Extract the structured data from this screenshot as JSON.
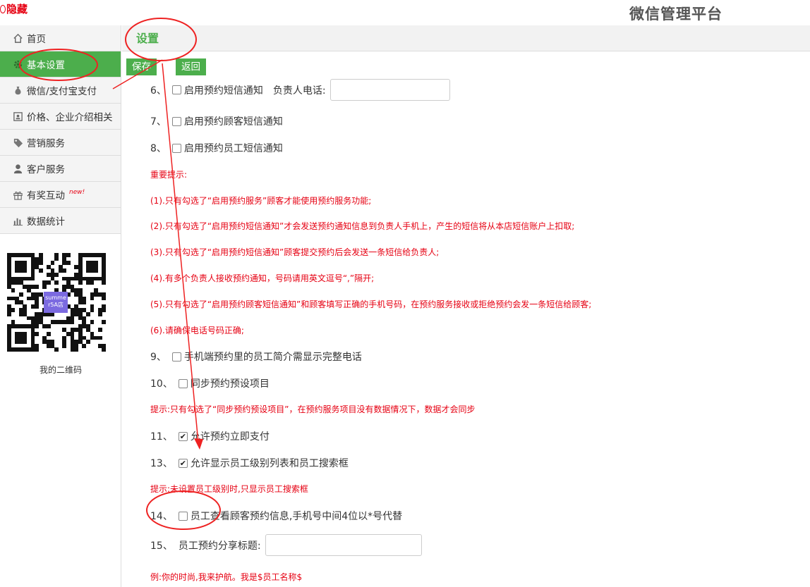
{
  "header": {
    "hide_label": "隐藏",
    "brand_title": "微信管理平台"
  },
  "sidebar": {
    "items": [
      {
        "label": "首页",
        "icon": "home-icon",
        "new_badge": ""
      },
      {
        "label": "基本设置",
        "icon": "gear-icon",
        "new_badge": ""
      },
      {
        "label": "微信/支付宝支付",
        "icon": "money-bag-icon",
        "new_badge": ""
      },
      {
        "label": "价格、企业介绍相关",
        "icon": "id-card-icon",
        "new_badge": ""
      },
      {
        "label": "营销服务",
        "icon": "tag-icon",
        "new_badge": ""
      },
      {
        "label": "客户服务",
        "icon": "user-icon",
        "new_badge": ""
      },
      {
        "label": "有奖互动",
        "icon": "gift-icon",
        "new_badge": "new!"
      },
      {
        "label": "数据统计",
        "icon": "bar-chart-icon",
        "new_badge": ""
      }
    ],
    "qr_badge": "summe r5A店",
    "qr_label": "我的二维码"
  },
  "page": {
    "title": "设置",
    "save_label": "保存",
    "back_label": "返回"
  },
  "settings": {
    "s6": {
      "num": "6、",
      "label": "启用预约短信通知",
      "checked": false,
      "field_label": "负责人电话:",
      "field_value": ""
    },
    "s7": {
      "num": "7、",
      "label": "启用预约顾客短信通知",
      "checked": false
    },
    "s8": {
      "num": "8、",
      "label": "启用预约员工短信通知",
      "checked": false
    },
    "tips_title": "重要提示:",
    "tips": [
      "(1).只有勾选了“启用预约服务”顾客才能使用预约服务功能;",
      "(2).只有勾选了“启用预约短信通知”才会发送预约通知信息到负责人手机上，产生的短信将从本店短信账户上扣取;",
      "(3).只有勾选了“启用预约短信通知”顾客提交预约后会发送一条短信给负责人;",
      "(4).有多个负责人接收预约通知，号码请用英文逗号“,”隔开;",
      "(5).只有勾选了“启用预约顾客短信通知”和顾客填写正确的手机号码，在预约服务接收或拒绝预约会发一条短信给顾客;",
      "(6).请确保电话号码正确;"
    ],
    "s9": {
      "num": "9、",
      "label": "手机端预约里的员工简介需显示完整电话",
      "checked": false
    },
    "s10": {
      "num": "10、",
      "label": "同步预约预设项目",
      "checked": false
    },
    "s10_note": "提示:只有勾选了“同步预约预设项目”，在预约服务项目没有数据情况下，数据才会同步",
    "s11": {
      "num": "11、",
      "label": "允许预约立即支付",
      "checked": true
    },
    "s13": {
      "num": "13、",
      "label": "允许显示员工级别列表和员工搜索框",
      "checked": true
    },
    "s13_note": "提示:未设置员工级别时,只显示员工搜索框",
    "s14": {
      "num": "14、",
      "label": "员工查看顾客预约信息,手机号中间4位以*号代替",
      "checked": false
    },
    "s15": {
      "num": "15、",
      "label": "员工预约分享标题:",
      "field_value": ""
    },
    "s15_note": "例:你的时尚,我来护航。我是$员工名称$"
  },
  "colors": {
    "accent_green": "#4cae4c",
    "alert_red": "#e60012",
    "annotation_red": "#ee2222"
  }
}
